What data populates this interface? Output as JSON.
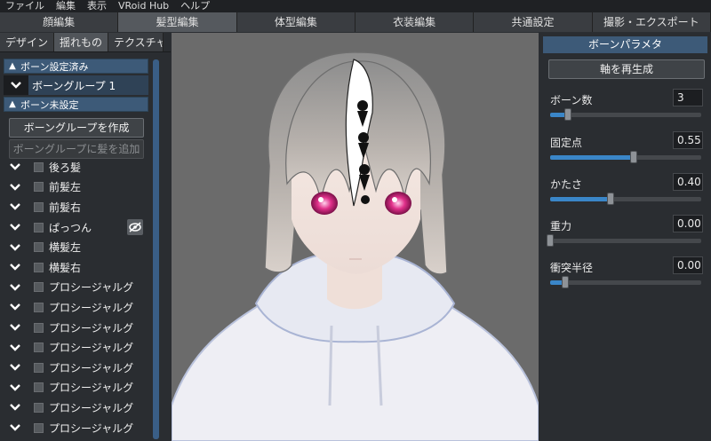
{
  "menu": [
    "ファイル",
    "編集",
    "表示",
    "VRoid Hub",
    "ヘルプ"
  ],
  "tabs": [
    "顔編集",
    "髪型編集",
    "体型編集",
    "衣装編集",
    "共通設定",
    "撮影・エクスポート"
  ],
  "active_tab": 1,
  "subtabs": [
    "デザイン",
    "揺れもの",
    "テクスチャ"
  ],
  "left": {
    "configured_section": "ボーン設定済み",
    "bone_group": "ボーングループ 1",
    "unconfigured_section": "ボーン未設定",
    "create_button": "ボーングループを作成",
    "add_hair_button": "ボーングループに髪を追加",
    "hair_items": [
      "後ろ髪",
      "前髪左",
      "前髪右",
      "ぱっつん",
      "横髪左",
      "横髪右",
      "プロシージャルグ",
      "プロシージャルグ",
      "プロシージャルグ",
      "プロシージャルグ",
      "プロシージャルグ",
      "プロシージャルグ",
      "プロシージャルグ",
      "プロシージャルグ"
    ],
    "hidden_item_index": 3
  },
  "right": {
    "title": "ボーンパラメタ",
    "regen_button": "軸を再生成",
    "params": [
      {
        "label": "ボーン数",
        "value": "3",
        "level": 0.12
      },
      {
        "label": "固定点",
        "value": "0.55",
        "level": 0.55
      },
      {
        "label": "かたさ",
        "value": "0.40",
        "level": 0.4
      },
      {
        "label": "重力",
        "value": "0.00",
        "level": 0.0
      },
      {
        "label": "衝突半径",
        "value": "0.00",
        "level": 0.1
      }
    ]
  },
  "colors": {
    "accent": "#3a86c8",
    "section_header": "#3d5a78",
    "viewport_bg": "#6b6b6b",
    "eye": "#e0308a"
  },
  "icons": {
    "section_chevron": "chevron-up-icon",
    "item_chevron": "chevron-down-icon",
    "hide": "eye-off-icon"
  }
}
